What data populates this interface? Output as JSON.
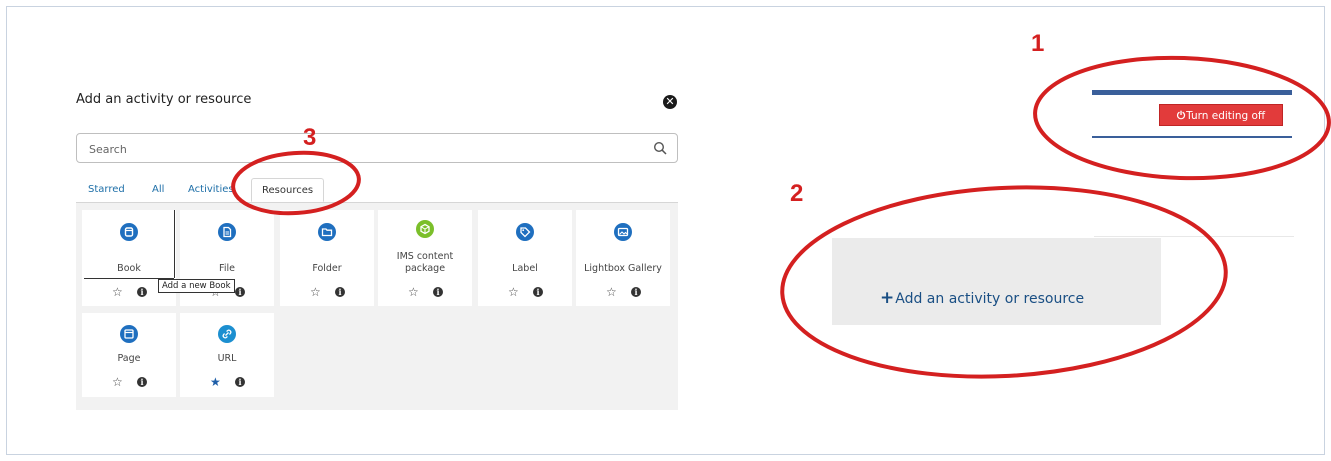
{
  "modal": {
    "title": "Add an activity or resource",
    "close_symbol": "✕",
    "search_placeholder": "Search",
    "tabs": [
      "Starred",
      "All",
      "Activities",
      "Resources"
    ],
    "active_tab": "Resources",
    "tooltip": "Add a new Book",
    "items": [
      {
        "label": "Book",
        "icon": "book-icon",
        "color": "#1f6fbf",
        "starred": false
      },
      {
        "label": "File",
        "icon": "file-icon",
        "color": "#1f6fbf",
        "starred": false
      },
      {
        "label": "Folder",
        "icon": "folder-icon",
        "color": "#1f6fbf",
        "starred": false
      },
      {
        "label": "IMS content package",
        "icon": "package-icon",
        "color": "#7bbf2a",
        "starred": false
      },
      {
        "label": "Label",
        "icon": "tag-icon",
        "color": "#1f6fbf",
        "starred": false
      },
      {
        "label": "Lightbox Gallery",
        "icon": "gallery-icon",
        "color": "#1f6fbf",
        "starred": false
      },
      {
        "label": "Page",
        "icon": "page-icon",
        "color": "#1f6fbf",
        "starred": false
      },
      {
        "label": "URL",
        "icon": "link-icon",
        "color": "#1c8fd0",
        "starred": true
      }
    ]
  },
  "annotations": [
    "1",
    "2",
    "3"
  ],
  "editing_button": {
    "label": "Turn editing off",
    "icon": "power-icon",
    "color": "#e23b3b"
  },
  "add_panel": {
    "label": "Add an activity or resource",
    "icon": "plus-icon"
  },
  "colors": {
    "annotation_red": "#d42020",
    "link_blue": "#1e6fa8",
    "bar_blue": "#3a5f9a"
  }
}
